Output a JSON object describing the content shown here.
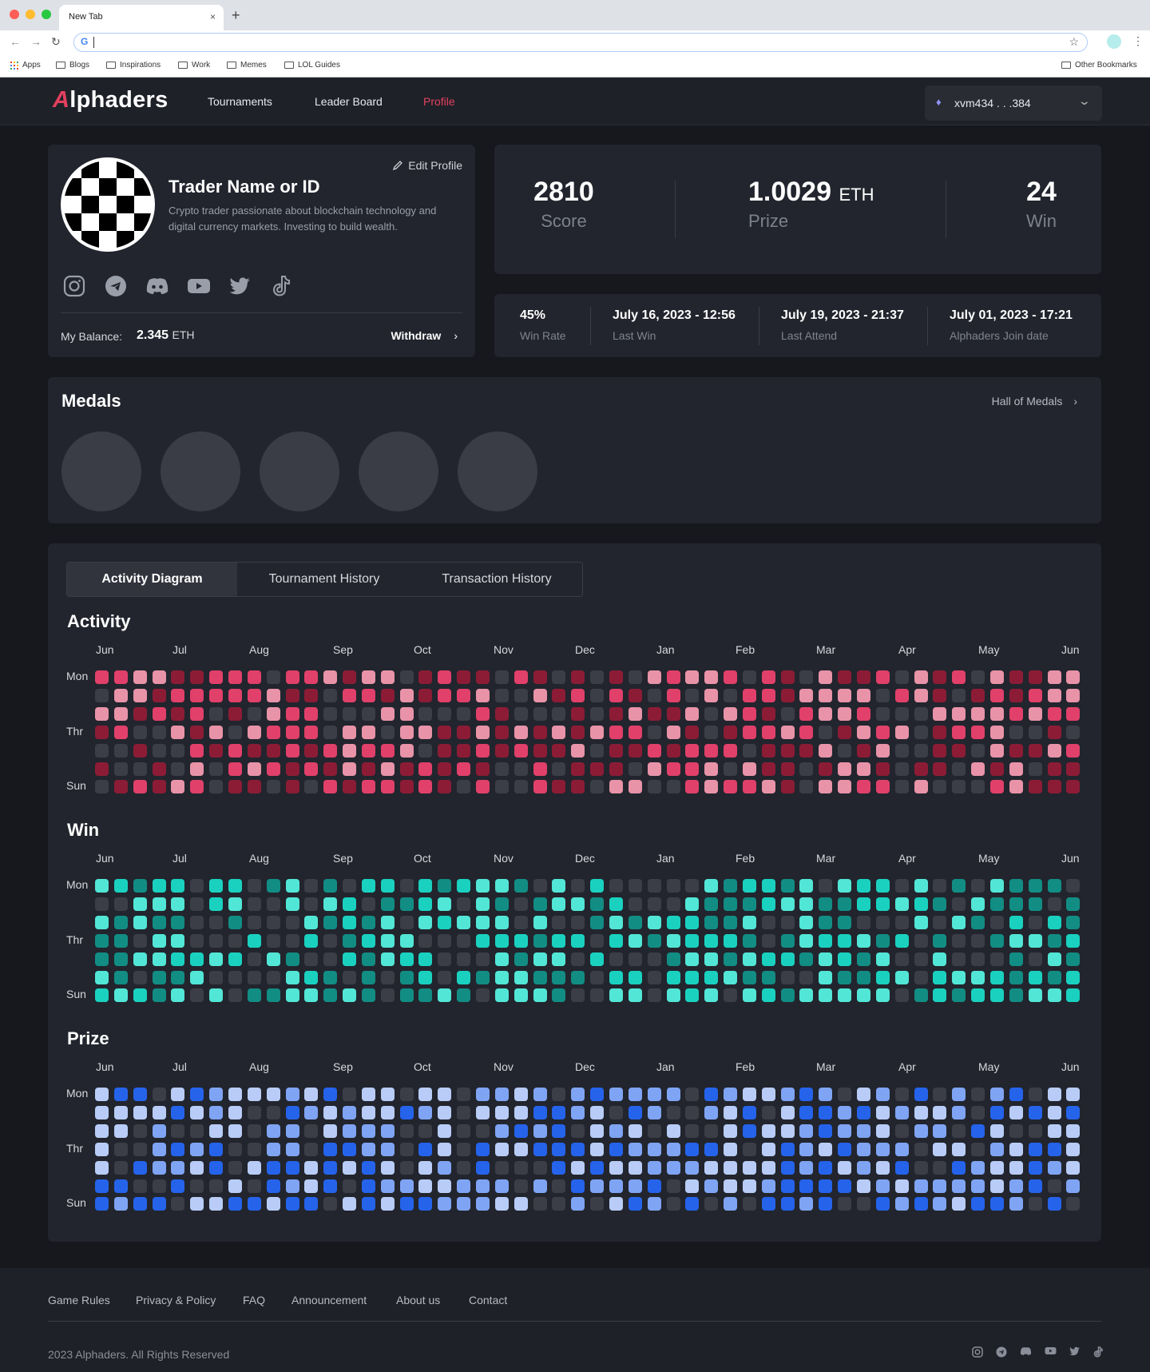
{
  "browser": {
    "tab_title": "New Tab",
    "tab_close": "×",
    "new_tab": "+",
    "address_value": "",
    "bookmarks": [
      "Apps",
      "Blogs",
      "Inspirations",
      "Work",
      "Memes",
      "LOL Guides"
    ],
    "other_bookmarks": "Other Bookmarks"
  },
  "header": {
    "logo": "lphaders",
    "logo_mark": "A",
    "nav": [
      "Tournaments",
      "Leader Board",
      "Profile"
    ],
    "active_nav": "Profile",
    "wallet": "xvm434 . . .384"
  },
  "profile": {
    "name": "Trader Name or ID",
    "bio": "Crypto trader passionate about blockchain technology and digital currency markets. Investing to build wealth.",
    "edit_label": "Edit Profile",
    "balance_label": "My Balance:",
    "balance_value": "2.345",
    "balance_unit": "ETH",
    "withdraw_label": "Withdraw",
    "socials": [
      "instagram-icon",
      "telegram-icon",
      "discord-icon",
      "youtube-icon",
      "twitter-icon",
      "tiktok-icon"
    ]
  },
  "stats": {
    "score_value": "2810",
    "score_label": "Score",
    "prize_value": "1.0029",
    "prize_unit": "ETH",
    "prize_label": "Prize",
    "win_value": "24",
    "win_label": "Win"
  },
  "info": {
    "win_rate_value": "45%",
    "win_rate_label": "Win Rate",
    "last_win_value": "July 16, 2023 - 12:56",
    "last_win_label": "Last Win",
    "last_attend_value": "July 19, 2023 - 21:37",
    "last_attend_label": "Last Attend",
    "join_value": "July 01, 2023 - 17:21",
    "join_label": "Alphaders Join date"
  },
  "medals": {
    "title": "Medals",
    "hall_label": "Hall of Medals",
    "count": 5
  },
  "activity_tabs": [
    "Activity Diagram",
    "Tournament History",
    "Transaction History"
  ],
  "heatmaps": {
    "months": [
      "Jun",
      "Jul",
      "Aug",
      "Sep",
      "Oct",
      "Nov",
      "Dec",
      "Jan",
      "Feb",
      "Mar",
      "Apr",
      "May",
      "Jun"
    ],
    "day_labels": [
      "Mon",
      "Thr",
      "Sun"
    ],
    "weeks": 52,
    "sections": [
      {
        "title": "Activity",
        "colors": [
          "#3b3e47",
          "#e893a8",
          "#e0406a",
          "#8c1c36"
        ]
      },
      {
        "title": "Win",
        "colors": [
          "#3b3e47",
          "#52e6d6",
          "#1ad1c0",
          "#128d84"
        ]
      },
      {
        "title": "Prize",
        "colors": [
          "#3b3e47",
          "#b8ccf7",
          "#7fa4f4",
          "#2563eb"
        ]
      }
    ]
  },
  "footer": {
    "links": [
      "Game Rules",
      "Privacy & Policy",
      "FAQ",
      "Announcement",
      "About us",
      "Contact"
    ],
    "copyright": "2023 Alphaders. All Rights Reserved"
  }
}
